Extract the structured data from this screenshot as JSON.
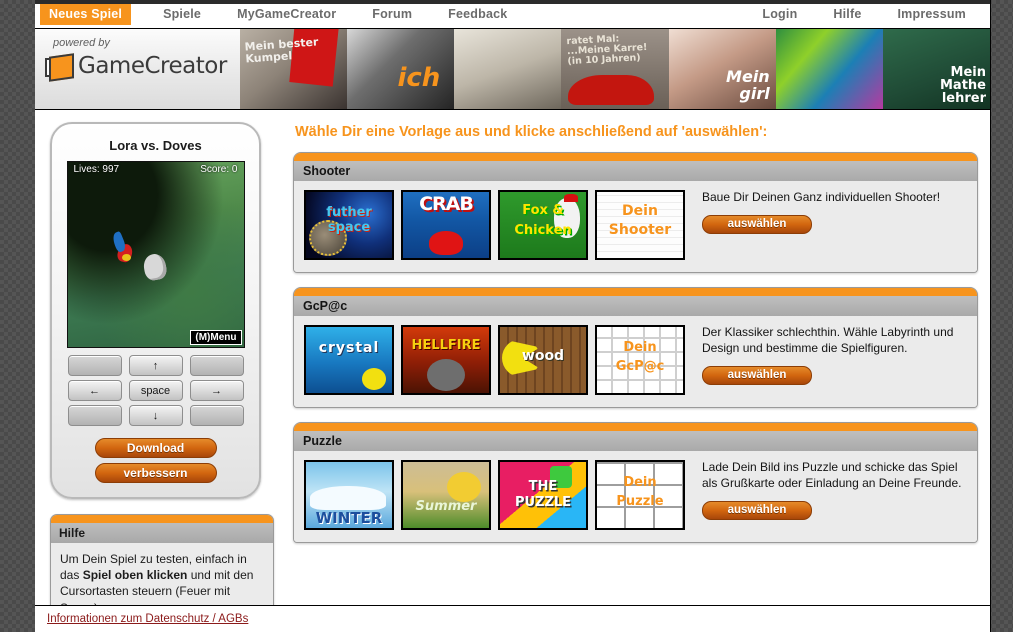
{
  "nav": {
    "items": [
      {
        "label": "Neues Spiel",
        "active": true
      },
      {
        "label": "Spiele",
        "active": false
      },
      {
        "label": "MyGameCreator",
        "active": false
      },
      {
        "label": "Forum",
        "active": false
      },
      {
        "label": "Feedback",
        "active": false
      }
    ],
    "right_items": [
      {
        "label": "Login"
      },
      {
        "label": "Hilfe"
      },
      {
        "label": "Impressum"
      }
    ]
  },
  "brand": {
    "powered_by": "powered by",
    "name": "GameCreator"
  },
  "banner": {
    "captions": [
      "Mein bester\nKumpel",
      "ich",
      "ratet Mal:\n...Meine Karre!\n(in 10 Jahren)",
      "Mein\ngirl",
      "Mein\nMathe\nlehrer"
    ]
  },
  "sidebar": {
    "game": {
      "title": "Lora vs. Doves",
      "lives_label": "Lives: 997",
      "score_label": "Score: 0",
      "menu_label": "(M)Menu",
      "keys": {
        "up": "↑",
        "down": "↓",
        "left": "←",
        "right": "→",
        "space": "space"
      },
      "download_label": "Download",
      "improve_label": "verbessern"
    },
    "help": {
      "title": "Hilfe",
      "text_part1": "Um Dein Spiel zu testen, einfach in das ",
      "text_bold": "Spiel oben klicken",
      "text_part2": " und mit den Cursortasten steuern (Feuer mit Space)."
    }
  },
  "main": {
    "headline": "Wähle Dir eine Vorlage aus und klicke anschließend auf 'auswählen':",
    "categories": [
      {
        "title": "Shooter",
        "description": "Baue Dir Deinen Ganz individuellen Shooter!",
        "select_label": "auswählen",
        "thumbs": [
          {
            "name": "futher space",
            "line1": "futher",
            "line2": "space"
          },
          {
            "name": "CRAB",
            "line1": "CRAB",
            "line2": ""
          },
          {
            "name": "Fox & Chicken",
            "line1": "Fox &",
            "line2": "Chicken"
          },
          {
            "name": "Dein Shooter",
            "line1": "Dein",
            "line2": "Shooter"
          }
        ]
      },
      {
        "title": "GcP@c",
        "description": "Der Klassiker schlechthin. Wähle Labyrinth und Design und bestimme die Spielfiguren.",
        "select_label": "auswählen",
        "thumbs": [
          {
            "name": "crystal",
            "line1": "crystal",
            "line2": ""
          },
          {
            "name": "HELLFIRE",
            "line1": "HELLFIRE",
            "line2": ""
          },
          {
            "name": "wood",
            "line1": "wood",
            "line2": ""
          },
          {
            "name": "Dein GcP@c",
            "line1": "Dein",
            "line2": "GcP@c"
          }
        ]
      },
      {
        "title": "Puzzle",
        "description": "Lade Dein Bild ins Puzzle und schicke das Spiel als Grußkarte oder Einladung an Deine Freunde.",
        "select_label": "auswählen",
        "thumbs": [
          {
            "name": "WINTER",
            "line1": "WINTER",
            "line2": ""
          },
          {
            "name": "Summer",
            "line1": "Summer",
            "line2": ""
          },
          {
            "name": "THE PUZZLE",
            "line1": "THE",
            "line2": "PUZZLE"
          },
          {
            "name": "Dein Puzzle",
            "line1": "Dein",
            "line2": "Puzzle"
          }
        ]
      }
    ]
  },
  "footer": {
    "link": "Informationen zum Datenschutz / AGBs"
  },
  "colors": {
    "accent": "#F7941D",
    "link": "#8b1a1a",
    "panel": "#ebebeb"
  }
}
